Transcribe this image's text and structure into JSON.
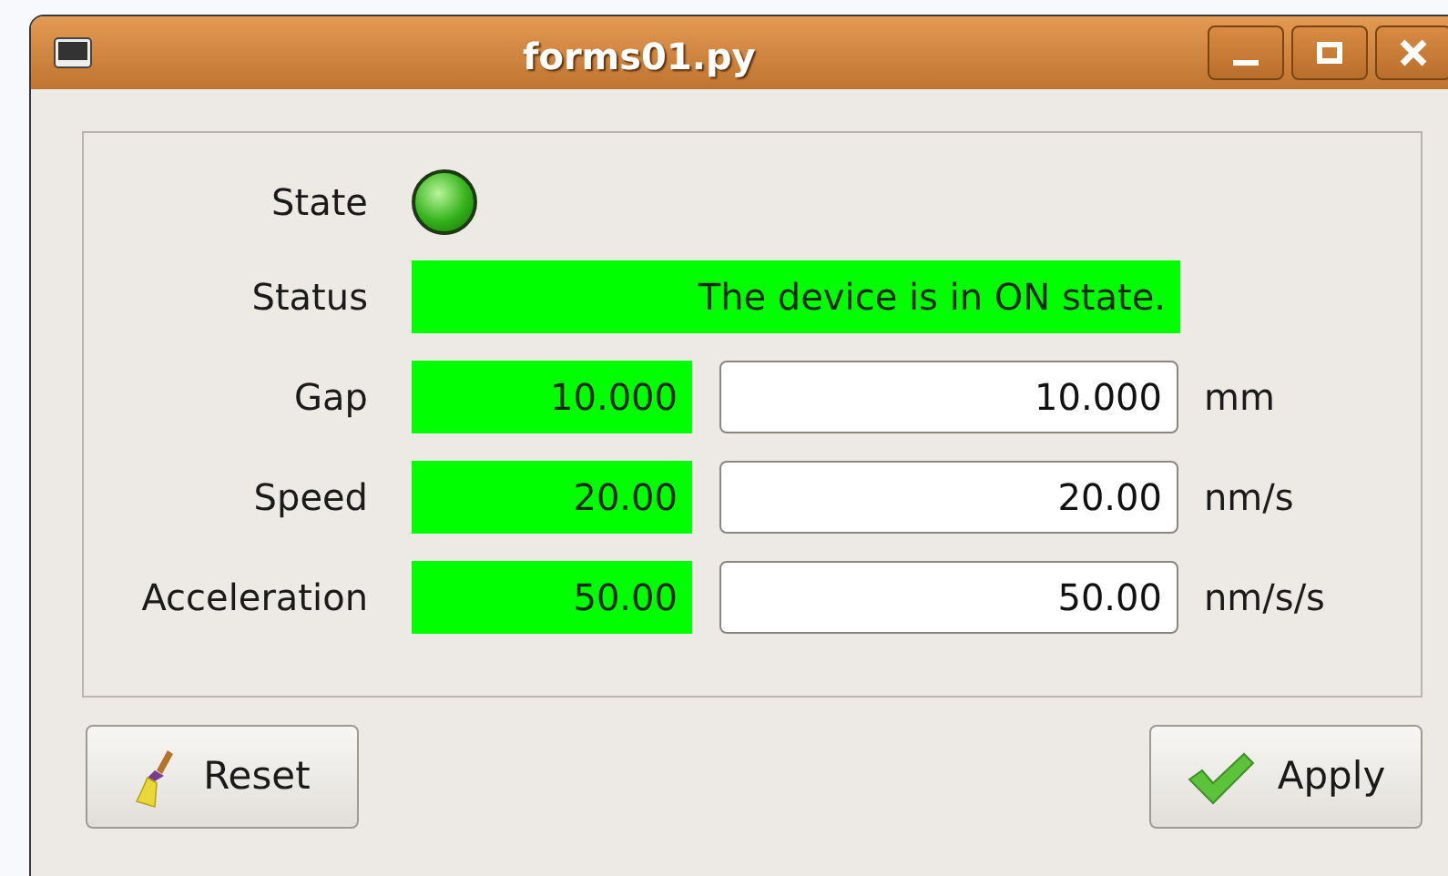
{
  "window": {
    "title": "forms01.py"
  },
  "state": {
    "label": "State",
    "on": true
  },
  "status": {
    "label": "Status",
    "reading": "The device is in ON state."
  },
  "rows": [
    {
      "label": "Gap",
      "reading": "10.000",
      "value": "10.000",
      "unit": "mm"
    },
    {
      "label": "Speed",
      "reading": "20.00",
      "value": "20.00",
      "unit": "nm/s"
    },
    {
      "label": "Acceleration",
      "reading": "50.00",
      "value": "50.00",
      "unit": "nm/s/s"
    }
  ],
  "buttons": [
    {
      "kind": "reset",
      "label": "Reset"
    },
    {
      "kind": "apply",
      "label": "Apply"
    }
  ]
}
